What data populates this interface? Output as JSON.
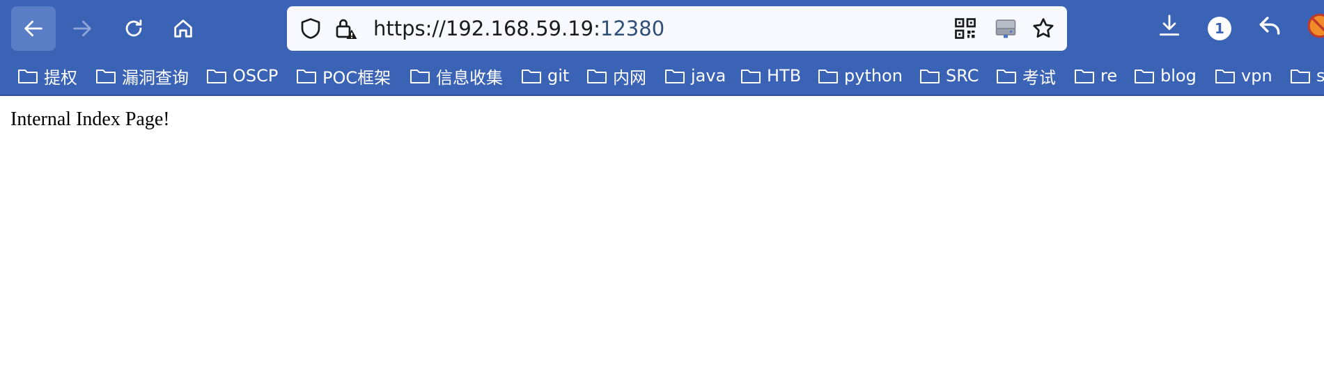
{
  "toolbar": {
    "back_icon": "arrow-left-icon",
    "forward_icon": "arrow-right-icon",
    "reload_icon": "reload-icon",
    "home_icon": "home-icon"
  },
  "urlbar": {
    "url_main": "https://192.168.59.19:",
    "url_port": "12380",
    "icons": [
      "shield-icon",
      "lock-warning-icon",
      "qr-code-icon",
      "drive-icon",
      "star-icon"
    ]
  },
  "right_toolbar": {
    "download_icon": "download-icon",
    "badge_count": "1",
    "reply_icon": "reply-icon"
  },
  "bookmarks": [
    {
      "label": "提权"
    },
    {
      "label": "漏洞查询"
    },
    {
      "label": "OSCP"
    },
    {
      "label": "POC框架"
    },
    {
      "label": "信息收集"
    },
    {
      "label": "git"
    },
    {
      "label": "内网"
    },
    {
      "label": "java"
    },
    {
      "label": "HTB"
    },
    {
      "label": "python"
    },
    {
      "label": "SRC"
    },
    {
      "label": "考试"
    },
    {
      "label": "re"
    },
    {
      "label": "blog"
    },
    {
      "label": "vpn"
    },
    {
      "label": "s"
    }
  ],
  "page": {
    "text": "Internal Index Page!"
  },
  "colors": {
    "chrome": "#3b63b5",
    "urlbar_bg": "#f8f9fe"
  }
}
